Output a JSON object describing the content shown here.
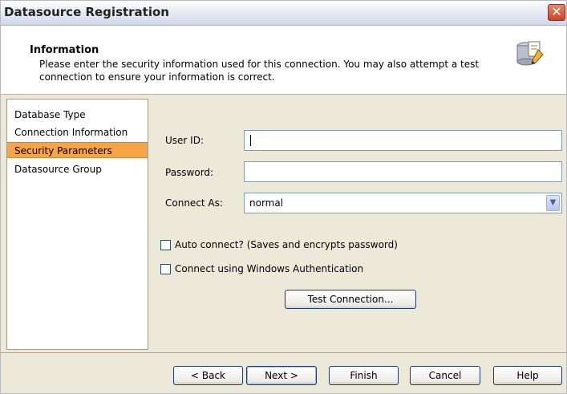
{
  "window": {
    "title": "Datasource Registration"
  },
  "header": {
    "title": "Information",
    "description": "Please enter the security information used for this connection.  You may also attempt a test connection to ensure your information is correct."
  },
  "nav": {
    "items": [
      {
        "label": "Database Type"
      },
      {
        "label": "Connection Information"
      },
      {
        "label": "Security Parameters",
        "selected": true
      },
      {
        "label": "Datasource Group"
      }
    ]
  },
  "form": {
    "user_id": {
      "label": "User ID:",
      "value": ""
    },
    "password": {
      "label": "Password:",
      "value": ""
    },
    "connect_as": {
      "label": "Connect As:",
      "value": "normal"
    },
    "auto_connect": {
      "label": "Auto connect? (Saves and encrypts password)",
      "checked": false
    },
    "windows_auth": {
      "label": "Connect using Windows Authentication",
      "checked": false
    },
    "test_button": "Test Connection..."
  },
  "footer": {
    "back": "< Back",
    "next": "Next >",
    "finish": "Finish",
    "cancel": "Cancel",
    "help": "Help"
  },
  "colors": {
    "selection": "#f5a547",
    "close_button": "#c8462a",
    "dialog_bg": "#ece9d8"
  }
}
